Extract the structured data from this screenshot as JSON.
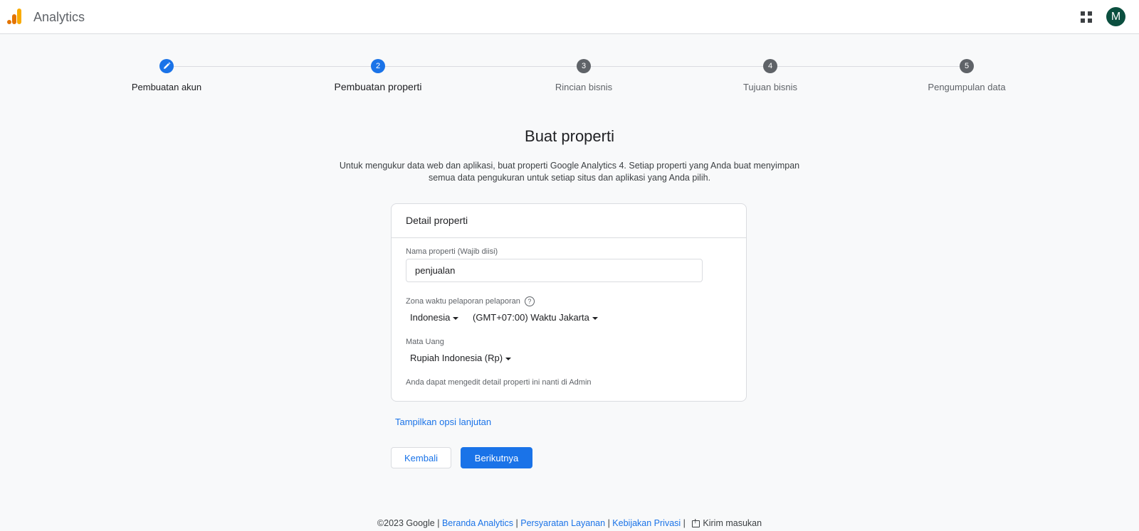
{
  "header": {
    "app_title": "Analytics",
    "logo_icon": "analytics-logo-icon",
    "apps_icon": "apps-grid-icon",
    "avatar_initial": "M",
    "avatar_color": "#0b4f3f"
  },
  "stepper": {
    "steps": [
      {
        "number": "",
        "label": "Pembuatan akun",
        "state": "completed",
        "icon": "pencil-icon"
      },
      {
        "number": "2",
        "label": "Pembuatan properti",
        "state": "active"
      },
      {
        "number": "3",
        "label": "Rincian bisnis",
        "state": "pending"
      },
      {
        "number": "4",
        "label": "Tujuan bisnis",
        "state": "pending"
      },
      {
        "number": "5",
        "label": "Pengumpulan data",
        "state": "pending"
      }
    ]
  },
  "main": {
    "title": "Buat properti",
    "description": "Untuk mengukur data web dan aplikasi, buat properti Google Analytics 4. Setiap properti yang Anda buat menyimpan semua data pengukuran untuk setiap situs dan aplikasi yang Anda pilih."
  },
  "card": {
    "header": "Detail properti",
    "property_name_label": "Nama properti (Wajib diisi)",
    "property_name_value": "penjualan",
    "timezone_label": "Zona waktu pelaporan pelaporan",
    "help_icon": "help-circle-icon",
    "country_value": "Indonesia",
    "timezone_value": "(GMT+07:00) Waktu Jakarta",
    "currency_label": "Mata Uang",
    "currency_value": "Rupiah Indonesia (Rp)",
    "note": "Anda dapat mengedit detail properti ini nanti di Admin"
  },
  "actions": {
    "advanced_link": "Tampilkan opsi lanjutan",
    "back_label": "Kembali",
    "next_label": "Berikutnya"
  },
  "footer": {
    "copyright": "©2023 Google",
    "sep": "|",
    "links": [
      "Beranda Analytics",
      "Persyaratan Layanan",
      "Kebijakan Privasi"
    ],
    "feedback_label": "Kirim masukan",
    "feedback_icon": "feedback-icon"
  },
  "colors": {
    "accent": "#1a73e8",
    "background": "#f8f9fa",
    "pending_step": "#5f6368"
  }
}
